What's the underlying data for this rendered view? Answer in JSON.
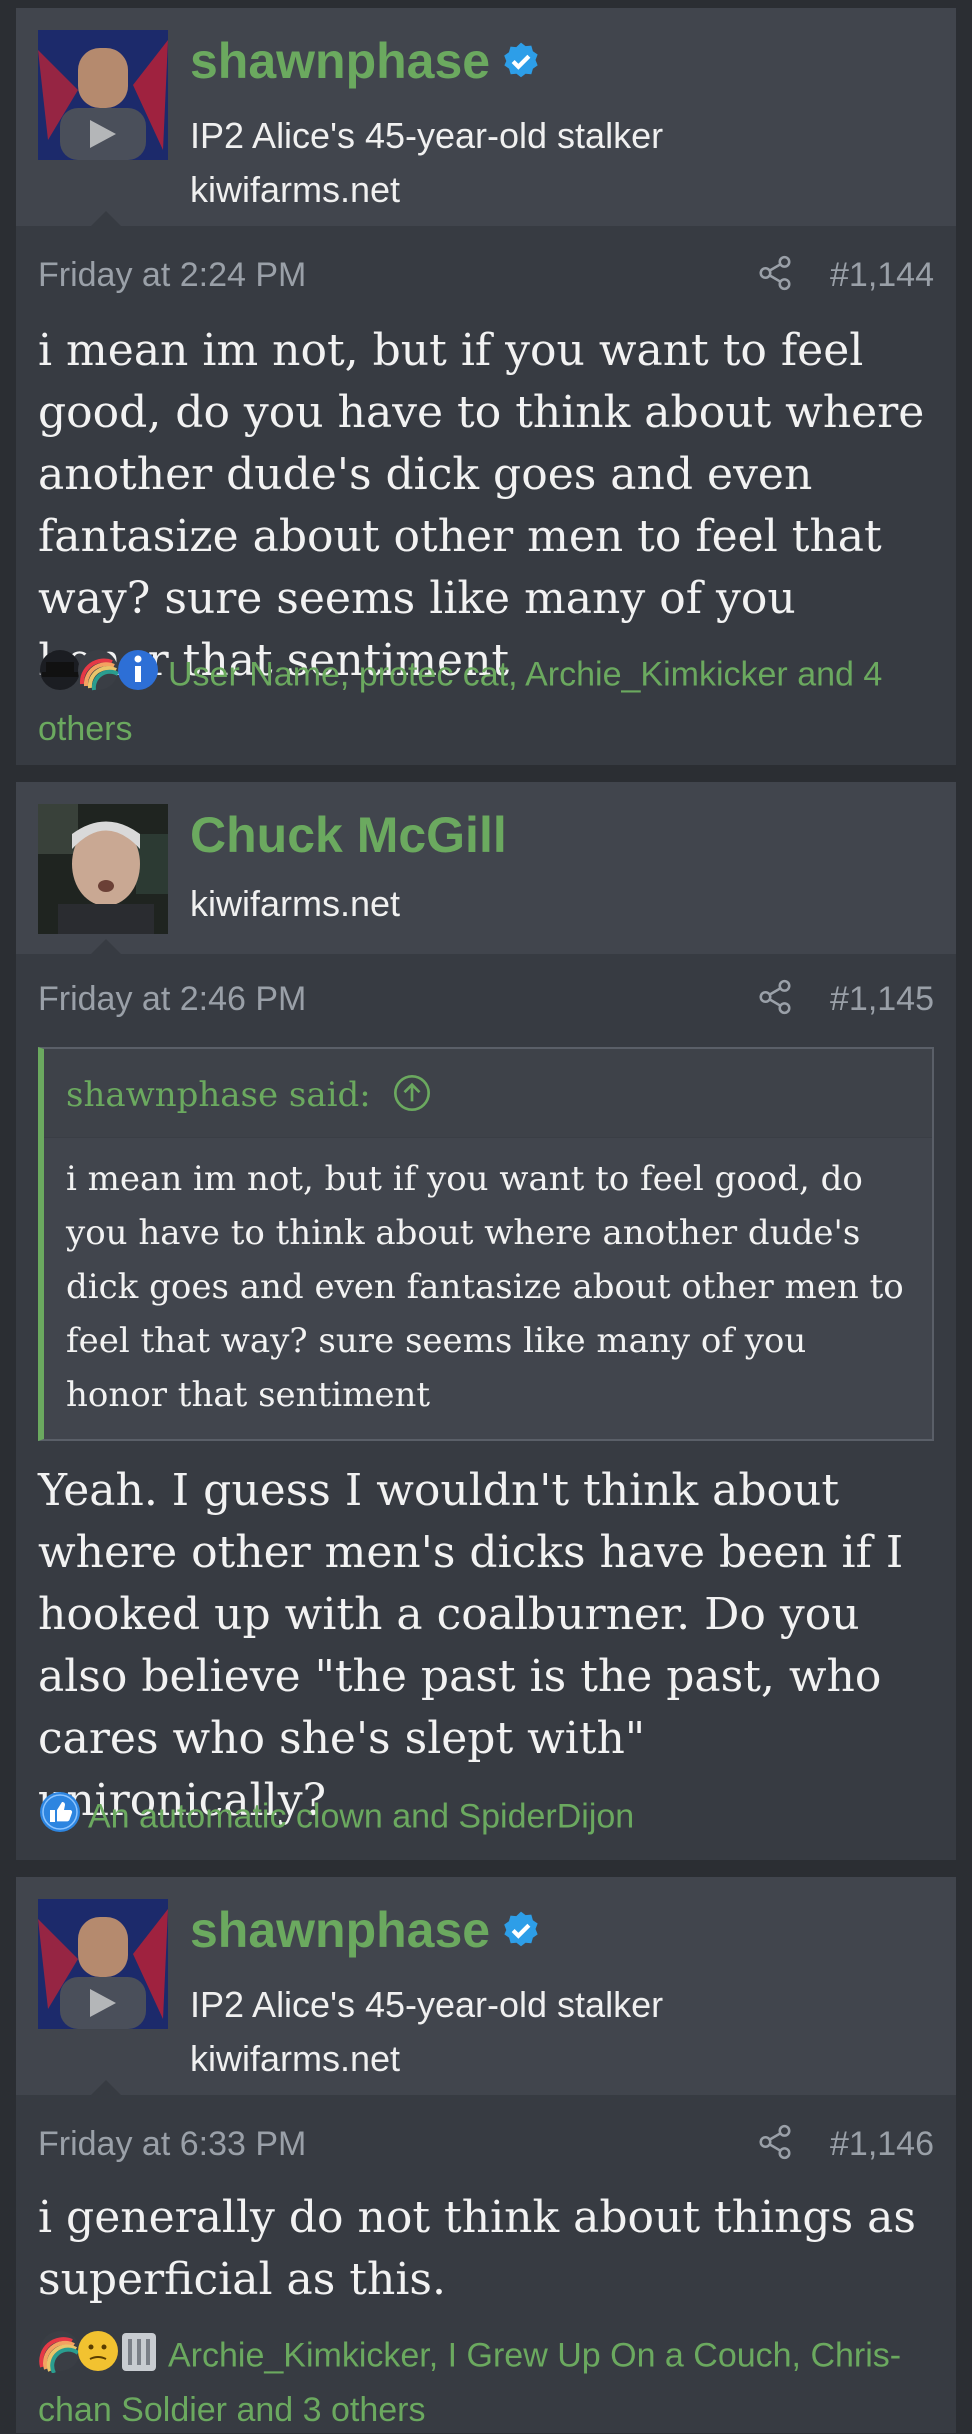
{
  "posts": [
    {
      "username": "shawnphase",
      "verified": true,
      "user_title": "IP2 Alice's 45-year-old stalker",
      "domain": "kiwifarms.net",
      "date": "Friday at 2:24 PM",
      "post_number": "#1,144",
      "body": "i mean im not, but if you want to feel good, do you have to think about where another dude's dick goes and even fantasize about other men to feel that way? sure seems like many of you honor that sentiment",
      "reactions": "User Name, protec cat, Archie_Kimkicker and 4 others"
    },
    {
      "username": "Chuck McGill",
      "verified": false,
      "domain": "kiwifarms.net",
      "date": "Friday at 2:46 PM",
      "post_number": "#1,145",
      "quote": {
        "author": "shawnphase said:",
        "text": "i mean im not, but if you want to feel good, do you have to think about where another dude's dick goes and even fantasize about other men to feel that way? sure seems like many of you honor that sentiment"
      },
      "body": "Yeah. I guess I wouldn't think about where other men's dicks have been if I hooked up with a coalburner. Do you also believe \"the past is the past, who cares who she's slept with\" unironically?",
      "reactions": "An automatic clown and SpiderDijon"
    },
    {
      "username": "shawnphase",
      "verified": true,
      "user_title": "IP2 Alice's 45-year-old stalker",
      "domain": "kiwifarms.net",
      "date": "Friday at 6:33 PM",
      "post_number": "#1,146",
      "body": "i generally do not think about things as superficial as this.",
      "reactions": "Archie_Kimkicker, I Grew Up On a Couch, Chris-chan Soldier and 3 others"
    }
  ],
  "colors": {
    "page_bg": "#2b2e33",
    "post_bg": "#373b42",
    "header_bg": "#41454d",
    "accent_green": "#6ba95f",
    "verified_blue": "#2d9ee8"
  }
}
